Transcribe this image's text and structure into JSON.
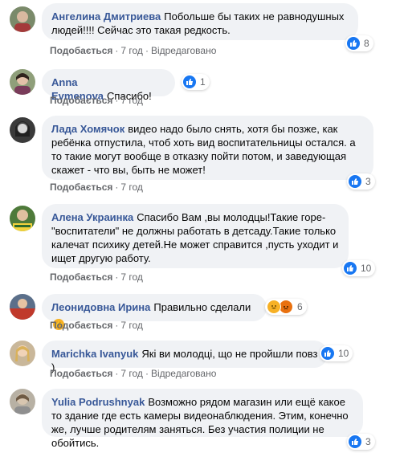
{
  "labels": {
    "like": "Подобається",
    "edited": "Відредаговано",
    "sep": "·"
  },
  "comments": [
    {
      "author": "Ангелина Дмитриева",
      "text": "Побольше бы таких не равнодушных людей!!!! Сейчас это такая редкость.",
      "time": "7 год",
      "edited": true,
      "reactions": "8",
      "avatar_color": "#7a8a6a"
    },
    {
      "author": "Anna Evmenova",
      "text": "Спасибо!",
      "time": "7 год",
      "edited": false,
      "reactions": "1",
      "avatar_color": "#8f9f7a"
    },
    {
      "author": "Лада Хомячок",
      "text": "видео надо было снять, хотя бы позже, как ребёнка отпустила, чтоб хоть вид воспитательницы остался. а то такие могут вообще в отказку пойти потом, и заведующая скажет - что вы, быть не может!",
      "time": "7 год",
      "edited": false,
      "reactions": "3",
      "avatar_color": "#3a3a3a"
    },
    {
      "author": "Алена Украинка",
      "text": "Спасибо Вам ,вы молодцы!Такие горе- \"воспитатели\" не должны работать в детсаду.Такие только калечат психику детей.Не может справится ,пусть уходит и ищет другую работу.",
      "time": "7 год",
      "edited": false,
      "reactions": "10",
      "avatar_color": "#4e7a3a"
    },
    {
      "author": "Леонидовна Ирина",
      "text": "Правильно сделали",
      "time": "7 год",
      "edited": false,
      "reactions": "6",
      "avatar_color": "#5b6f8a"
    },
    {
      "author": "Marichka Ivanyuk",
      "text": "Які ви молодці, що не пройшли повз )",
      "time": "7 год",
      "edited": true,
      "reactions": "10",
      "avatar_color": "#c9b79a"
    },
    {
      "author": "Yulia Podrushnyak",
      "text": "Возможно рядом магазин или ещё какое то здание где есть камеры видеонаблюдения. Этим, конечно же, лучше родителям заняться. Без участия полиции не обойтись.",
      "time": "7 год",
      "edited": false,
      "reactions": "3",
      "avatar_color": "#b8b1a4"
    }
  ],
  "colors": {
    "bubble": "#f0f2f5",
    "author": "#385898",
    "meta": "#65676b",
    "like_blue": "#1877f2"
  }
}
